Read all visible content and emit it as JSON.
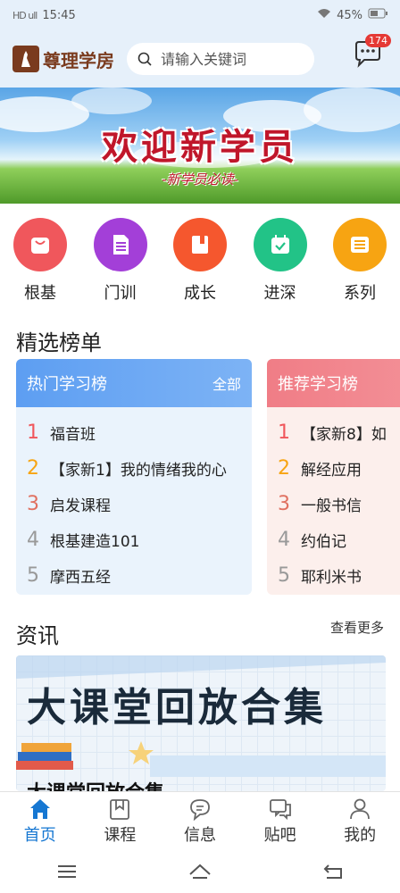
{
  "status_bar": {
    "signal": "HD ull",
    "time": "15:45",
    "battery": "45%"
  },
  "header": {
    "logo_text": "尊理学房",
    "search_placeholder": "请输入关键词",
    "message_badge": "174"
  },
  "banner": {
    "title": "欢迎新学员",
    "subtitle": "-新学员必读-"
  },
  "categories": [
    {
      "label": "根基",
      "color": "#f0575c",
      "icon": "bag-icon"
    },
    {
      "label": "门训",
      "color": "#a33fd8",
      "icon": "document-icon"
    },
    {
      "label": "成长",
      "color": "#f5572e",
      "icon": "book-icon"
    },
    {
      "label": "进深",
      "color": "#22c387",
      "icon": "calendar-check-icon"
    },
    {
      "label": "系列",
      "color": "#f7a412",
      "icon": "list-icon"
    }
  ],
  "rankings": {
    "section_title": "精选榜单",
    "hot": {
      "title": "热门学习榜",
      "action": "全部",
      "items": [
        {
          "num": "1",
          "text": "福音班"
        },
        {
          "num": "2",
          "text": "【家新1】我的情绪我的心"
        },
        {
          "num": "3",
          "text": "启发课程"
        },
        {
          "num": "4",
          "text": "根基建造101"
        },
        {
          "num": "5",
          "text": "摩西五经"
        }
      ]
    },
    "recommend": {
      "title": "推荐学习榜",
      "items": [
        {
          "num": "1",
          "text": "【家新8】如"
        },
        {
          "num": "2",
          "text": "解经应用"
        },
        {
          "num": "3",
          "text": "一般书信"
        },
        {
          "num": "4",
          "text": "约伯记"
        },
        {
          "num": "5",
          "text": "耶利米书"
        }
      ]
    },
    "rank_colors": [
      "#f0575c",
      "#f7a412",
      "#f0575c",
      "#999999",
      "#999999"
    ]
  },
  "news": {
    "section_title": "资讯",
    "more_label": "查看更多",
    "banner_title": "大课堂回放合集",
    "caption": "大课堂回放合集"
  },
  "tabbar": [
    {
      "label": "首页",
      "icon": "home-icon",
      "active": true
    },
    {
      "label": "课程",
      "icon": "bookmark-icon",
      "active": false
    },
    {
      "label": "信息",
      "icon": "chat-bubble-icon",
      "active": false
    },
    {
      "label": "贴吧",
      "icon": "comments-icon",
      "active": false
    },
    {
      "label": "我的",
      "icon": "user-icon",
      "active": false
    }
  ],
  "accent_color": "#1677d2"
}
